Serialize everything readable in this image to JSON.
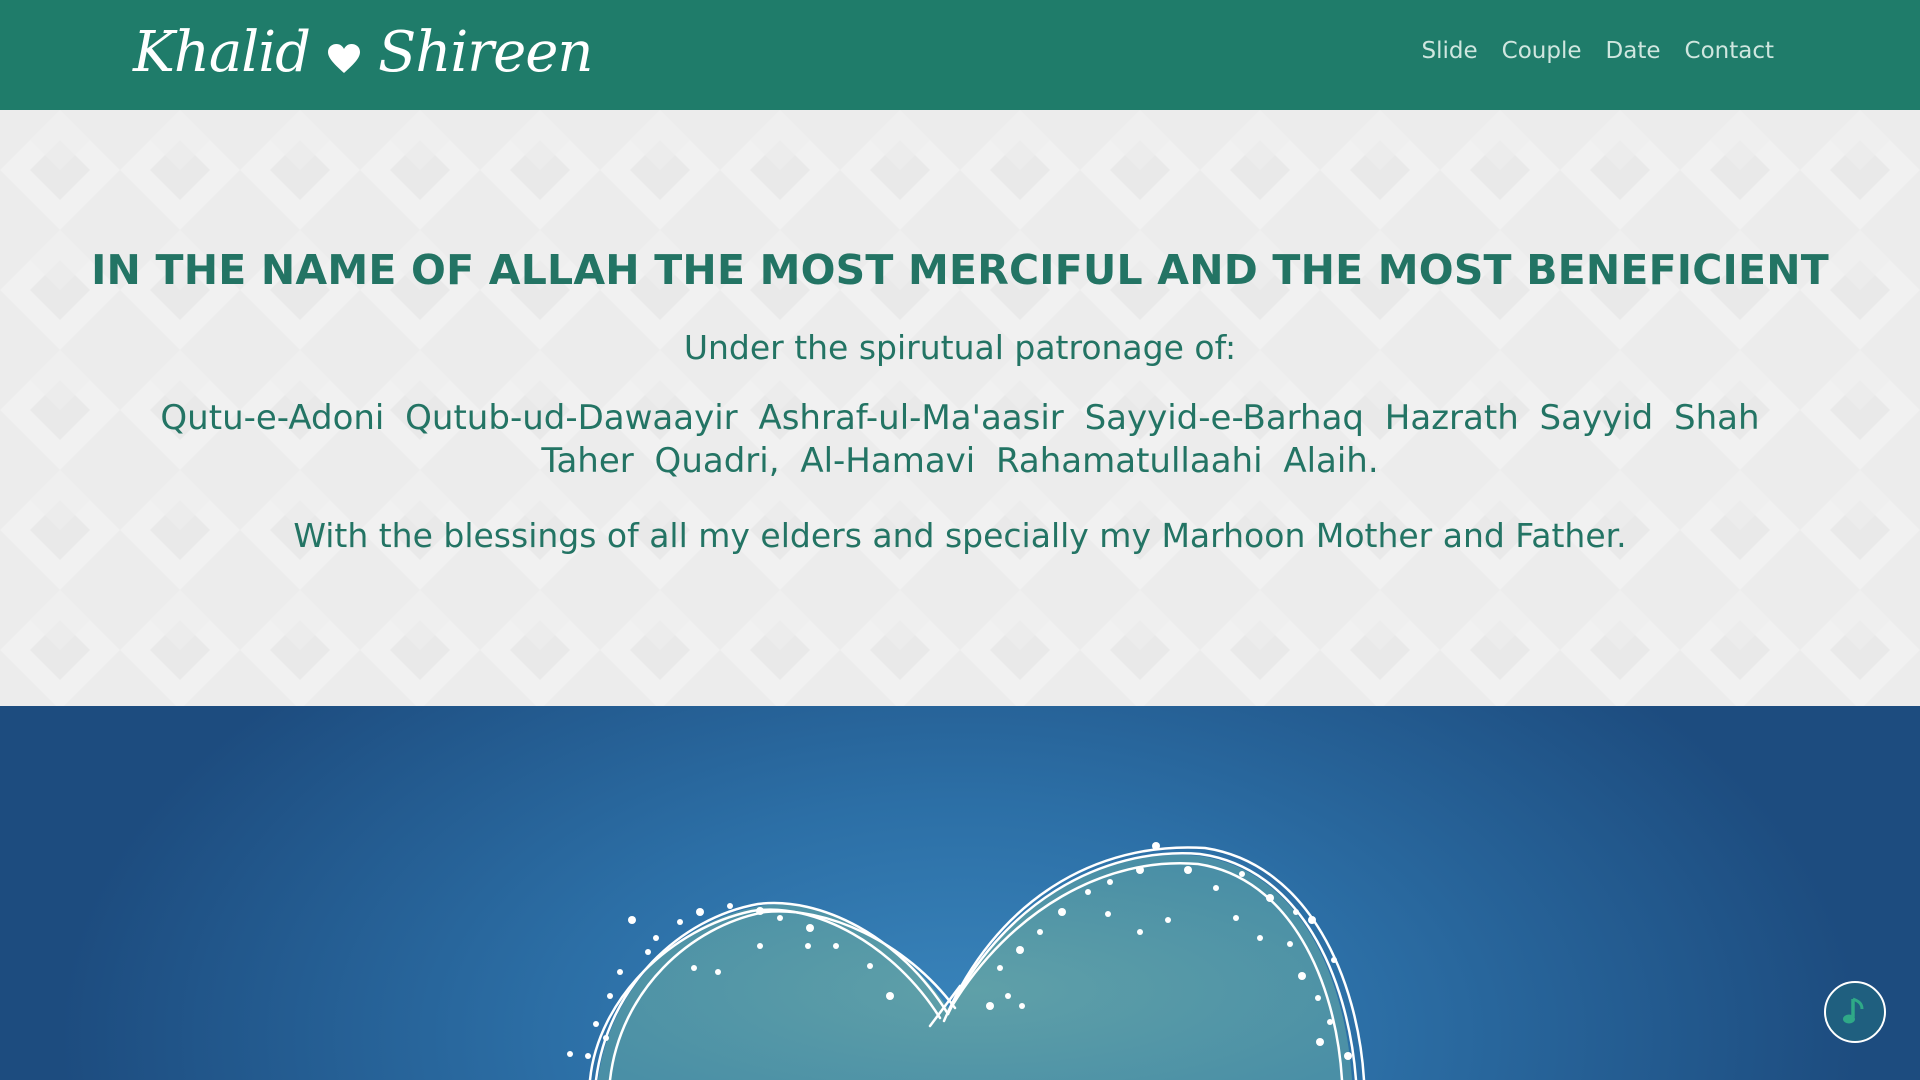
{
  "navbar": {
    "brand_first": "Khalid",
    "brand_second": "Shireen",
    "links": [
      "Slide",
      "Couple",
      "Date",
      "Contact"
    ]
  },
  "intro": {
    "invocation": "IN THE NAME OF ALLAH THE MOST MERCIFUL AND THE MOST BENEFICIENT",
    "patronage_label": "Under the spirutual patronage of:",
    "names": "Qutu-e-Adoni Qutub-ud-Dawaayir Ashraf-ul-Ma'aasir Sayyid-e-Barhaq Hazrath Sayyid Shah Taher Quadri, Al-Hamavi Rahamatullaahi Alaih.",
    "blessings": "With the blessings of all my elders and specially my Marhoon Mother and Father."
  },
  "icons": {
    "brand_heart": "heart-icon",
    "music": "music-note-icon",
    "hero": "sparkle-heart-illustration"
  },
  "colors": {
    "navbar_bg": "#1f7c6a",
    "text_teal": "#237464",
    "hero_blue": "#2c6fa6"
  }
}
